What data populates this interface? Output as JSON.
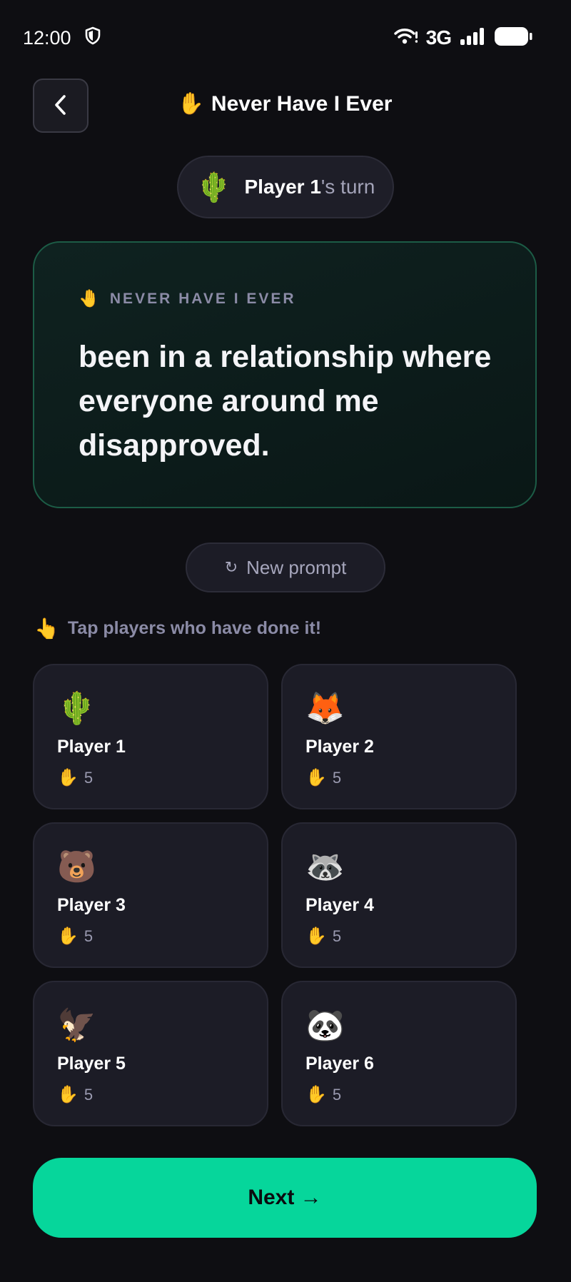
{
  "status_bar": {
    "time": "12:00",
    "network": "3G",
    "icons": [
      "shield-icon",
      "wifi-icon",
      "signal-icon",
      "battery-icon"
    ]
  },
  "header": {
    "title_emoji": "✋",
    "title": "Never Have I Ever",
    "back_icon": "chevron-left-icon"
  },
  "turn": {
    "emoji": "🌵",
    "player_name": "Player 1",
    "suffix": "'s turn"
  },
  "prompt": {
    "label_emoji": "🤚",
    "label": "NEVER HAVE I EVER",
    "text": "been in a relationship where everyone around me disapproved."
  },
  "new_prompt": {
    "icon": "↻",
    "label": "New prompt"
  },
  "instruction": {
    "emoji": "👆",
    "text": "Tap players who have done it!"
  },
  "players": [
    {
      "avatar": "🌵",
      "name": "Player 1",
      "score_emoji": "✋",
      "score": "5"
    },
    {
      "avatar": "🦊",
      "name": "Player 2",
      "score_emoji": "✋",
      "score": "5"
    },
    {
      "avatar": "🐻",
      "name": "Player 3",
      "score_emoji": "✋",
      "score": "5"
    },
    {
      "avatar": "🦝",
      "name": "Player 4",
      "score_emoji": "✋",
      "score": "5"
    },
    {
      "avatar": "🦅",
      "name": "Player 5",
      "score_emoji": "✋",
      "score": "5"
    },
    {
      "avatar": "🐼",
      "name": "Player 6",
      "score_emoji": "✋",
      "score": "5"
    }
  ],
  "next_button": {
    "label": "Next →"
  },
  "colors": {
    "background": "#0e0e12",
    "accent": "#06d69b",
    "card": "#1c1c26",
    "prompt_border": "#1c5c46",
    "muted_text": "#8b8ba6"
  }
}
